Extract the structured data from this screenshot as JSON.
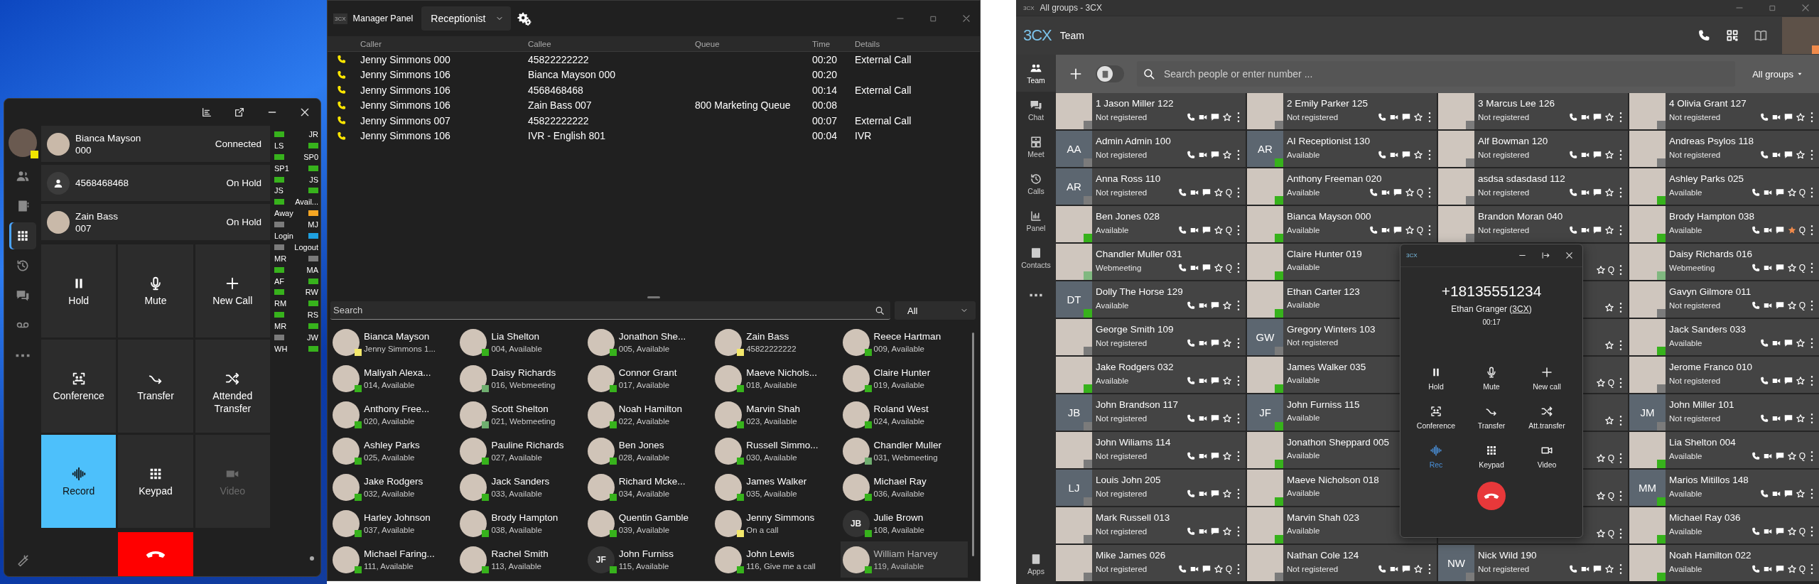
{
  "phone_window": {
    "profile": {
      "color": "#f2e600"
    },
    "nav": [
      {
        "kind": "people",
        "selected": false
      },
      {
        "kind": "addressbook",
        "selected": false
      },
      {
        "kind": "keypad",
        "selected": true
      },
      {
        "kind": "history",
        "selected": false
      },
      {
        "kind": "chat",
        "selected": false
      },
      {
        "kind": "voicemail",
        "selected": false
      },
      {
        "kind": "more",
        "selected": false
      }
    ],
    "calls": [
      {
        "kind": "photo",
        "name": "Bianca Mayson",
        "number": "000",
        "status": "Connected"
      },
      {
        "kind": "generic",
        "name": "4568468468",
        "status": "On Hold"
      },
      {
        "kind": "photo",
        "name": "Zain Bass",
        "number": "007",
        "status": "On Hold"
      }
    ],
    "buttons": [
      {
        "kind": "hold",
        "label": "Hold",
        "active": false,
        "disabled": false
      },
      {
        "kind": "mute",
        "label": "Mute",
        "active": false,
        "disabled": false
      },
      {
        "kind": "newcall",
        "label": "New Call",
        "active": false,
        "disabled": false
      },
      {
        "kind": "conference",
        "label": "Conference",
        "active": false,
        "disabled": false
      },
      {
        "kind": "transfer",
        "label": "Transfer",
        "active": false,
        "disabled": false
      },
      {
        "kind": "atttransfer",
        "label": "Attended Transfer",
        "active": false,
        "disabled": false
      },
      {
        "kind": "record",
        "label": "Record",
        "active": true,
        "disabled": false
      },
      {
        "kind": "keypad",
        "label": "Keypad",
        "active": false,
        "disabled": false
      },
      {
        "kind": "video",
        "label": "Video",
        "active": false,
        "disabled": true
      }
    ],
    "presence": [
      {
        "label": "JR",
        "color": "#37b21c"
      },
      {
        "label": "LS",
        "color": "#37b21c"
      },
      {
        "label": "SP0",
        "color": "#37b21c"
      },
      {
        "label": "SP1",
        "color": "#37b21c"
      },
      {
        "label": "JS",
        "color": "#37b21c"
      },
      {
        "label": "JS",
        "color": "#37b21c"
      },
      {
        "label": "Avail...",
        "color": "#37b21c"
      },
      {
        "label": "Away",
        "color": "#f5a623"
      },
      {
        "label": "MJ",
        "color": "#7b7b7b"
      },
      {
        "label": "Login",
        "color": "#1ea0e0"
      },
      {
        "label": "Logout",
        "color": "#7b7b7b"
      },
      {
        "label": "MR",
        "color": "#7b7b7b"
      },
      {
        "label": "MA",
        "color": "#37b21c"
      },
      {
        "label": "AF",
        "color": "#37b21c"
      },
      {
        "label": "RW",
        "color": "#37b21c"
      },
      {
        "label": "RM",
        "color": "#37b21c"
      },
      {
        "label": "RS",
        "color": "#37b21c"
      },
      {
        "label": "MR",
        "color": "#37b21c"
      },
      {
        "label": "JW",
        "color": "#7b7b7b"
      },
      {
        "label": "WH",
        "color": "#37b21c"
      }
    ]
  },
  "manager_panel": {
    "logo": "3CX",
    "title": "Manager Panel",
    "role": "Receptionist",
    "columns": [
      "Caller",
      "Callee",
      "Queue",
      "Time",
      "Details"
    ],
    "rows": [
      {
        "caller": "Jenny Simmons 000",
        "callee": "45822222222",
        "time": "00:20",
        "details": "External Call"
      },
      {
        "caller": "Jenny Simmons 106",
        "callee": "Bianca Mayson 000",
        "time": "00:20"
      },
      {
        "caller": "Jenny Simmons 106",
        "callee": "4568468468",
        "time": "00:14",
        "details": "External Call"
      },
      {
        "caller": "Jenny Simmons 106",
        "callee": "Zain Bass 007",
        "queue": "800 Marketing Queue",
        "time": "00:08"
      },
      {
        "caller": "Jenny Simmons 007",
        "callee": "45822222222",
        "time": "00:07",
        "details": "External Call"
      },
      {
        "caller": "Jenny Simmons 106",
        "callee": "IVR - English 801",
        "time": "00:04",
        "details": "IVR"
      }
    ],
    "search": {
      "placeholder": "Search"
    },
    "filter": "All",
    "contacts": [
      {
        "kind": "photo",
        "name": "Bianca Mayson",
        "detail": "Jenny Simmons 1...",
        "color": "#f3e86b",
        "selected": false
      },
      {
        "kind": "photo",
        "name": "Lia Shelton",
        "detail": "004, Available",
        "color": "#37b21c",
        "selected": false
      },
      {
        "kind": "photo",
        "name": "Jonathon She...",
        "detail": "005, Available",
        "color": "#37b21c",
        "selected": false
      },
      {
        "kind": "photo",
        "name": "Zain Bass",
        "detail": "45822222222",
        "color": "#f3e86b",
        "selected": false
      },
      {
        "kind": "photo",
        "name": "Reece Hartman",
        "detail": "009, Available",
        "color": "#37b21c",
        "selected": false
      },
      {
        "kind": "photo",
        "name": "Maliyah Alexa...",
        "detail": "014, Available",
        "color": "#37b21c",
        "selected": false
      },
      {
        "kind": "photo",
        "name": "Daisy Richards",
        "detail": "016, Webmeeting",
        "color": "#6fae6f",
        "selected": false
      },
      {
        "kind": "photo",
        "name": "Connor Grant",
        "detail": "017, Available",
        "color": "#37b21c",
        "selected": false
      },
      {
        "kind": "photo",
        "name": "Maeve Nichols...",
        "detail": "018, Available",
        "color": "#37b21c",
        "selected": false
      },
      {
        "kind": "photo",
        "name": "Claire Hunter",
        "detail": "019, Available",
        "color": "#37b21c",
        "selected": false
      },
      {
        "kind": "photo",
        "name": "Anthony Free...",
        "detail": "020, Available",
        "color": "#37b21c",
        "selected": false
      },
      {
        "kind": "photo",
        "name": "Scott Shelton",
        "detail": "021, Webmeeting",
        "color": "#6fae6f",
        "selected": false
      },
      {
        "kind": "photo",
        "name": "Noah Hamilton",
        "detail": "022, Available",
        "color": "#37b21c",
        "selected": false
      },
      {
        "kind": "photo",
        "name": "Marvin Shah",
        "detail": "023, Available",
        "color": "#37b21c",
        "selected": false
      },
      {
        "kind": "photo",
        "name": "Roland West",
        "detail": "024, Available",
        "color": "#37b21c",
        "selected": false
      },
      {
        "kind": "photo",
        "name": "Ashley Parks",
        "detail": "025, Available",
        "color": "#37b21c",
        "selected": false
      },
      {
        "kind": "photo",
        "name": "Pauline Richards",
        "detail": "027, Available",
        "color": "#37b21c",
        "selected": false
      },
      {
        "kind": "photo",
        "name": "Ben Jones",
        "detail": "028, Available",
        "color": "#37b21c",
        "selected": false
      },
      {
        "kind": "photo",
        "name": "Russell Simmo...",
        "detail": "030, Available",
        "color": "#37b21c",
        "selected": false
      },
      {
        "kind": "photo",
        "name": "Chandler Muller",
        "detail": "031, Webmeeting",
        "color": "#6fae6f",
        "selected": false
      },
      {
        "kind": "photo",
        "name": "Jake Rodgers",
        "detail": "032, Available",
        "color": "#37b21c",
        "selected": false
      },
      {
        "kind": "photo",
        "name": "Jack Sanders",
        "detail": "033, Available",
        "color": "#37b21c",
        "selected": false
      },
      {
        "kind": "photo",
        "name": "Richard Mcke...",
        "detail": "034, Available",
        "color": "#37b21c",
        "selected": false
      },
      {
        "kind": "photo",
        "name": "James Walker",
        "detail": "035, Available",
        "color": "#37b21c",
        "selected": false
      },
      {
        "kind": "photo",
        "name": "Michael Ray",
        "detail": "036, Available",
        "color": "#37b21c",
        "selected": false
      },
      {
        "kind": "photo",
        "name": "Harley Johnson",
        "detail": "037, Available",
        "color": "#37b21c",
        "selected": false
      },
      {
        "kind": "photo",
        "name": "Brody Hampton",
        "detail": "038, Available",
        "color": "#37b21c",
        "selected": false
      },
      {
        "kind": "photo",
        "name": "Quentin Gamble",
        "detail": "039, Available",
        "color": "#37b21c",
        "selected": false
      },
      {
        "kind": "photo",
        "name": "Jenny Simmons",
        "detail": "On a call",
        "color": "#f3e86b",
        "selected": false
      },
      {
        "kind": "initials",
        "initials": "JB",
        "name": "Julie Brown",
        "detail": "108, Available",
        "color": "#37b21c",
        "selected": false
      },
      {
        "kind": "photo",
        "name": "Michael Faring...",
        "detail": "111, Available",
        "color": "#37b21c",
        "selected": false
      },
      {
        "kind": "photo",
        "name": "Rachel Smith",
        "detail": "113, Available",
        "color": "#37b21c",
        "selected": false
      },
      {
        "kind": "initials",
        "initials": "JF",
        "name": "John Furniss",
        "detail": "115, Available",
        "color": "#37b21c",
        "selected": false
      },
      {
        "kind": "photo",
        "name": "John Lewis",
        "detail": "116, Give me a call",
        "color": "#37b21c",
        "selected": false
      },
      {
        "kind": "photo",
        "name": "William Harvey",
        "detail": "119, Available",
        "color": "#37b21c",
        "selected": true
      }
    ]
  },
  "team_app": {
    "window_logo": "3CX",
    "window_title": "All groups - 3CX",
    "logo": "3CX",
    "title": "Team",
    "profile": {
      "color": "#f08a4b"
    },
    "nav": [
      {
        "kind": "team",
        "label": "Team",
        "selected": true
      },
      {
        "kind": "chat",
        "label": "Chat",
        "selected": false
      },
      {
        "kind": "meet",
        "label": "Meet",
        "selected": false
      },
      {
        "kind": "calls",
        "label": "Calls",
        "selected": false
      },
      {
        "kind": "panel",
        "label": "Panel",
        "selected": false
      },
      {
        "kind": "contacts",
        "label": "Contacts",
        "selected": false
      },
      {
        "kind": "more",
        "selected": false
      }
    ],
    "apps": {
      "label": "Apps"
    },
    "toggle": {
      "on": false
    },
    "search": {
      "placeholder": "Search people or enter number ..."
    },
    "group_filter": "All groups",
    "contacts": [
      {
        "kind": "photo",
        "name": "1 Jason Miller 122",
        "status": "Not registered",
        "color": "#7b7b7b",
        "favorite": false
      },
      {
        "kind": "initials",
        "initials": "AA",
        "name": "Admin Admin 100",
        "status": "Not registered",
        "color": "#7b7b7b",
        "favorite": false
      },
      {
        "kind": "initials",
        "initials": "AR",
        "name": "Anna Ross 110",
        "status": "Not registered",
        "color": "#7b7b7b",
        "favorite": false,
        "q": "Q"
      },
      {
        "kind": "photo",
        "name": "Ben Jones 028",
        "status": "Available",
        "color": "#37b21c",
        "favorite": false,
        "q": "Q"
      },
      {
        "kind": "photo",
        "name": "Chandler Muller 031",
        "status": "Webmeeting",
        "color": "#80b880",
        "favorite": false,
        "q": "Q"
      },
      {
        "kind": "initials",
        "initials": "DT",
        "name": "Dolly The Horse 129",
        "status": "Available",
        "color": "#37b21c",
        "favorite": false
      },
      {
        "kind": "photo",
        "name": "George Smith 109",
        "status": "Not registered",
        "color": "#7b7b7b",
        "favorite": false
      },
      {
        "kind": "photo",
        "name": "Jake Rodgers 032",
        "status": "Available",
        "color": "#37b21c",
        "favorite": false
      },
      {
        "kind": "initials",
        "initials": "JB",
        "name": "John Brandson 117",
        "status": "Not registered",
        "color": "#7b7b7b",
        "favorite": false
      },
      {
        "kind": "photo",
        "name": "John Wiliams 114",
        "status": "Not registered",
        "color": "#7b7b7b",
        "favorite": false
      },
      {
        "kind": "initials",
        "initials": "LJ",
        "name": "Louis John 205",
        "status": "Not registered",
        "color": "#7b7b7b",
        "favorite": false
      },
      {
        "kind": "photo",
        "name": "Mark Russell 013",
        "status": "Not registered",
        "color": "#7b7b7b",
        "favorite": false
      },
      {
        "kind": "photo",
        "name": "Mike James 026",
        "status": "Not registered",
        "color": "#7b7b7b",
        "favorite": false,
        "q": "Q"
      },
      {
        "kind": "photo",
        "name": "2 Emily Parker 125",
        "status": "Not registered",
        "color": "#7b7b7b",
        "favorite": false
      },
      {
        "kind": "initials",
        "initials": "AR",
        "name": "AI Receptionist 130",
        "status": "Available",
        "color": "#37b21c",
        "favorite": false
      },
      {
        "kind": "photo",
        "name": "Anthony Freeman 020",
        "status": "Available",
        "color": "#37b21c",
        "favorite": false,
        "q": "Q"
      },
      {
        "kind": "photo",
        "name": "Bianca Mayson 000",
        "status": "Available",
        "color": "#37b21c",
        "favorite": false,
        "q": "Q"
      },
      {
        "kind": "photo",
        "name": "Claire Hunter 019",
        "status": "Available",
        "color": "#37b21c",
        "covered": true
      },
      {
        "kind": "photo",
        "name": "Ethan Carter 123",
        "status": "Available",
        "color": "#37b21c",
        "covered": true
      },
      {
        "kind": "initials",
        "initials": "GW",
        "name": "Gregory Winters 103",
        "status": "Not registered",
        "color": "#7b7b7b",
        "covered": true
      },
      {
        "kind": "photo",
        "name": "James Walker 035",
        "status": "Available",
        "color": "#37b21c",
        "covered": true
      },
      {
        "kind": "initials",
        "initials": "JF",
        "name": "John Furniss 115",
        "status": "Available",
        "color": "#37b21c",
        "covered": true
      },
      {
        "kind": "photo",
        "name": "Jonathon Sheppard 005",
        "status": "Available",
        "color": "#37b21c",
        "covered": true
      },
      {
        "kind": "photo",
        "name": "Maeve Nicholson 018",
        "status": "Available",
        "color": "#37b21c",
        "covered": true
      },
      {
        "kind": "photo",
        "name": "Marvin Shah 023",
        "status": "Available",
        "color": "#37b21c",
        "covered": true
      },
      {
        "kind": "photo",
        "name": "Nathan Cole 124",
        "status": "Not registered",
        "color": "#7b7b7b",
        "favorite": false
      },
      {
        "kind": "photo",
        "name": "3 Marcus Lee 126",
        "status": "Not registered",
        "color": "#7b7b7b",
        "favorite": false
      },
      {
        "kind": "photo",
        "name": "Alf Bowman 120",
        "status": "Not registered",
        "color": "#7b7b7b",
        "favorite": false
      },
      {
        "kind": "photo",
        "name": "asdsa sdasdasd 112",
        "status": "Not registered",
        "color": "#7b7b7b",
        "favorite": false
      },
      {
        "kind": "photo",
        "name": "Brandon Moran 040",
        "status": "Not registered",
        "color": "#7b7b7b",
        "favorite": false
      },
      {
        "kind": "covered",
        "favorite": false,
        "q": "Q"
      },
      {
        "kind": "covered",
        "favorite": false
      },
      {
        "kind": "covered",
        "favorite": false
      },
      {
        "kind": "covered",
        "favorite": false,
        "q": "Q"
      },
      {
        "kind": "covered",
        "favorite": false
      },
      {
        "kind": "covered",
        "favorite": false,
        "q": "Q"
      },
      {
        "kind": "covered",
        "favorite": false,
        "q": "Q"
      },
      {
        "kind": "covered",
        "favorite": false,
        "q": "Q"
      },
      {
        "kind": "initials",
        "initials": "NW",
        "name": "Nick Wild 190",
        "status": "Not registered",
        "color": "#7b7b7b",
        "favorite": false
      },
      {
        "kind": "photo",
        "name": "4 Olivia Grant 127",
        "status": "Not registered",
        "color": "#7b7b7b",
        "favorite": false
      },
      {
        "kind": "photo",
        "name": "Andreas Psylos 118",
        "status": "Not registered",
        "color": "#7b7b7b",
        "favorite": false
      },
      {
        "kind": "photo",
        "name": "Ashley Parks 025",
        "status": "Available",
        "color": "#37b21c",
        "favorite": false,
        "q": "Q"
      },
      {
        "kind": "photo",
        "name": "Brody Hampton 038",
        "status": "Available",
        "color": "#37b21c",
        "favorite": true,
        "q": "Q"
      },
      {
        "kind": "photo",
        "name": "Daisy Richards 016",
        "status": "Webmeeting",
        "color": "#80b880",
        "favorite": false,
        "q": "Q"
      },
      {
        "kind": "photo",
        "name": "Gavyn Gilmore 011",
        "status": "Not registered",
        "color": "#7b7b7b",
        "favorite": false,
        "q": "Q"
      },
      {
        "kind": "photo",
        "name": "Jack Sanders 033",
        "status": "Available",
        "color": "#37b21c",
        "favorite": false
      },
      {
        "kind": "photo",
        "name": "Jerome Franco 010",
        "status": "Not registered",
        "color": "#7b7b7b",
        "favorite": false
      },
      {
        "kind": "initials",
        "initials": "JM",
        "name": "John Miller 101",
        "status": "Not registered",
        "color": "#7b7b7b",
        "favorite": false
      },
      {
        "kind": "photo",
        "name": "Lia Shelton 004",
        "status": "Available",
        "color": "#37b21c",
        "favorite": false,
        "q": "Q"
      },
      {
        "kind": "initials",
        "initials": "MM",
        "name": "Marios Mitillos 148",
        "status": "Available",
        "color": "#37b21c",
        "favorite": false
      },
      {
        "kind": "photo",
        "name": "Michael Ray 036",
        "status": "Available",
        "color": "#37b21c",
        "favorite": false,
        "q": "Q"
      },
      {
        "kind": "photo",
        "name": "Noah Hamilton 022",
        "status": "Available",
        "color": "#37b21c",
        "favorite": false,
        "q": "Q"
      }
    ],
    "call_popup": {
      "logo": "3CX",
      "number": "+18135551234",
      "caller_prefix": "Ethan Granger (",
      "company": "3CX",
      "caller_suffix": ")",
      "duration": "00:17",
      "buttons": [
        {
          "kind": "hold",
          "label": "Hold",
          "active": false
        },
        {
          "kind": "mute",
          "label": "Mute",
          "active": false
        },
        {
          "kind": "newcall",
          "label": "New call",
          "active": false
        },
        {
          "kind": "conference",
          "label": "Conference",
          "active": false
        },
        {
          "kind": "transfer",
          "label": "Transfer",
          "active": false
        },
        {
          "kind": "atttransfer",
          "label": "Att.transfer",
          "active": false
        },
        {
          "kind": "record",
          "label": "Rec",
          "active": true
        },
        {
          "kind": "keypad",
          "label": "Keypad",
          "active": false
        },
        {
          "kind": "videoline",
          "label": "Video",
          "active": false
        }
      ]
    }
  }
}
